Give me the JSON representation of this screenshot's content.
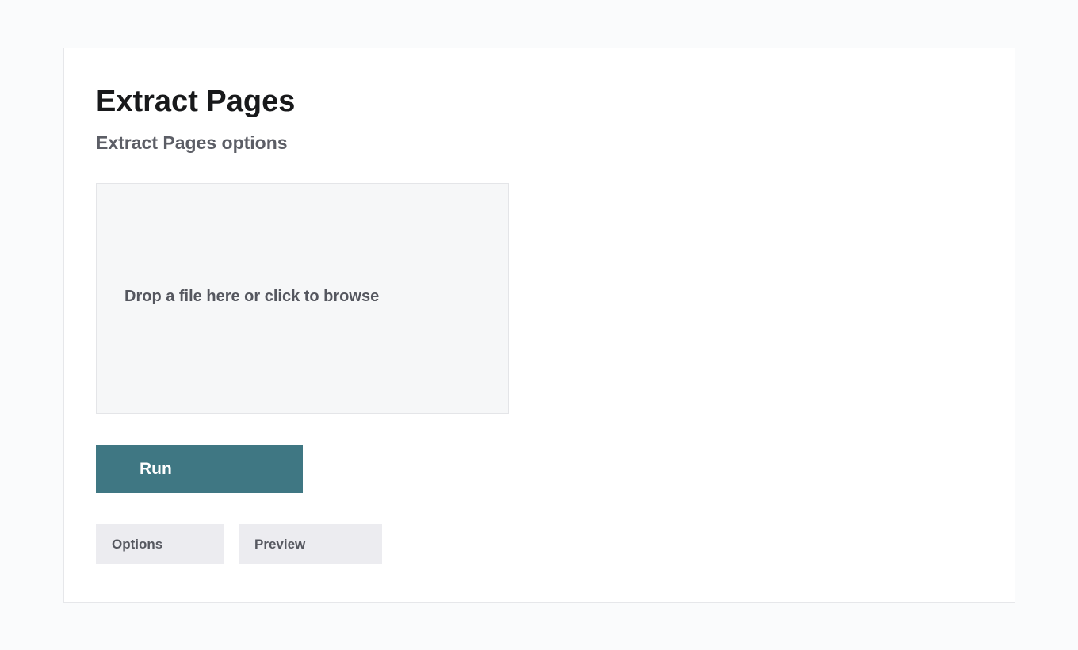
{
  "page": {
    "title": "Extract Pages",
    "subtitle": "Extract Pages options"
  },
  "dropzone": {
    "prompt": "Drop a file here or click to browse"
  },
  "actions": {
    "run_label": "Run"
  },
  "tabs": [
    {
      "label": "Options"
    },
    {
      "label": "Preview"
    }
  ],
  "colors": {
    "accent": "#3f7783",
    "background": "#fafbfc",
    "card": "#ffffff",
    "tab_background": "#ececf0",
    "dropzone_background": "#f6f7f8"
  }
}
